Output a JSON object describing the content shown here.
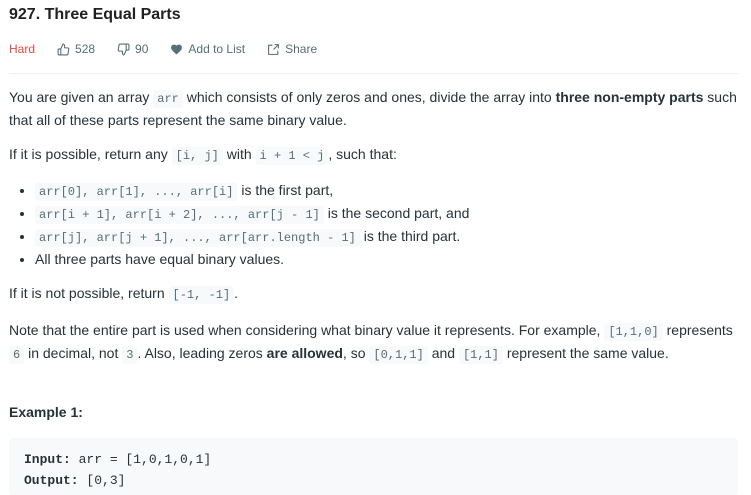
{
  "problem": {
    "title": "927. Three Equal Parts",
    "difficulty": "Hard",
    "likes": "528",
    "dislikes": "90",
    "add_to_list": "Add to List",
    "share": "Share"
  },
  "description": {
    "p1": [
      {
        "t": "You are given an array "
      },
      {
        "c": "arr"
      },
      {
        "t": " which consists of only zeros and ones, divide the array into "
      },
      {
        "b": "three non-empty parts"
      },
      {
        "t": " such that all of these parts represent the same binary value."
      }
    ],
    "p2": [
      {
        "t": "If it is possible, return any "
      },
      {
        "c": "[i, j]"
      },
      {
        "t": " with "
      },
      {
        "c": "i + 1 < j"
      },
      {
        "t": ", such that:"
      }
    ],
    "list": [
      [
        {
          "c": "arr[0], arr[1], ..., arr[i]"
        },
        {
          "t": " is the first part,"
        }
      ],
      [
        {
          "c": "arr[i + 1], arr[i + 2], ..., arr[j - 1]"
        },
        {
          "t": " is the second part, and"
        }
      ],
      [
        {
          "c": "arr[j], arr[j + 1], ..., arr[arr.length - 1]"
        },
        {
          "t": " is the third part."
        }
      ],
      [
        {
          "t": "All three parts have equal binary values."
        }
      ]
    ],
    "p3": [
      {
        "t": "If it is not possible, return "
      },
      {
        "c": "[-1, -1]"
      },
      {
        "t": "."
      }
    ],
    "p4": [
      {
        "t": "Note that the entire part is used when considering what binary value it represents. For example, "
      },
      {
        "c": "[1,1,0]"
      },
      {
        "t": " represents "
      },
      {
        "c": "6"
      },
      {
        "t": " in decimal, not "
      },
      {
        "c": "3"
      },
      {
        "t": ". Also, leading zeros "
      },
      {
        "b": "are allowed"
      },
      {
        "t": ", so "
      },
      {
        "c": "[0,1,1]"
      },
      {
        "t": " and "
      },
      {
        "c": "[1,1]"
      },
      {
        "t": " represent the same value."
      }
    ]
  },
  "example": {
    "heading": "Example 1:",
    "input_label": "Input:",
    "input_value": " arr = [1,0,1,0,1]",
    "output_label": "Output:",
    "output_value": " [0,3]"
  },
  "colors": {
    "hard": "#ef4743",
    "meta": "#546e7a",
    "code_bg": "#f7f9fa",
    "code_text": "#546e7a"
  },
  "icons": [
    "thumbs-up-icon",
    "thumbs-down-icon",
    "heart-icon",
    "share-icon"
  ]
}
